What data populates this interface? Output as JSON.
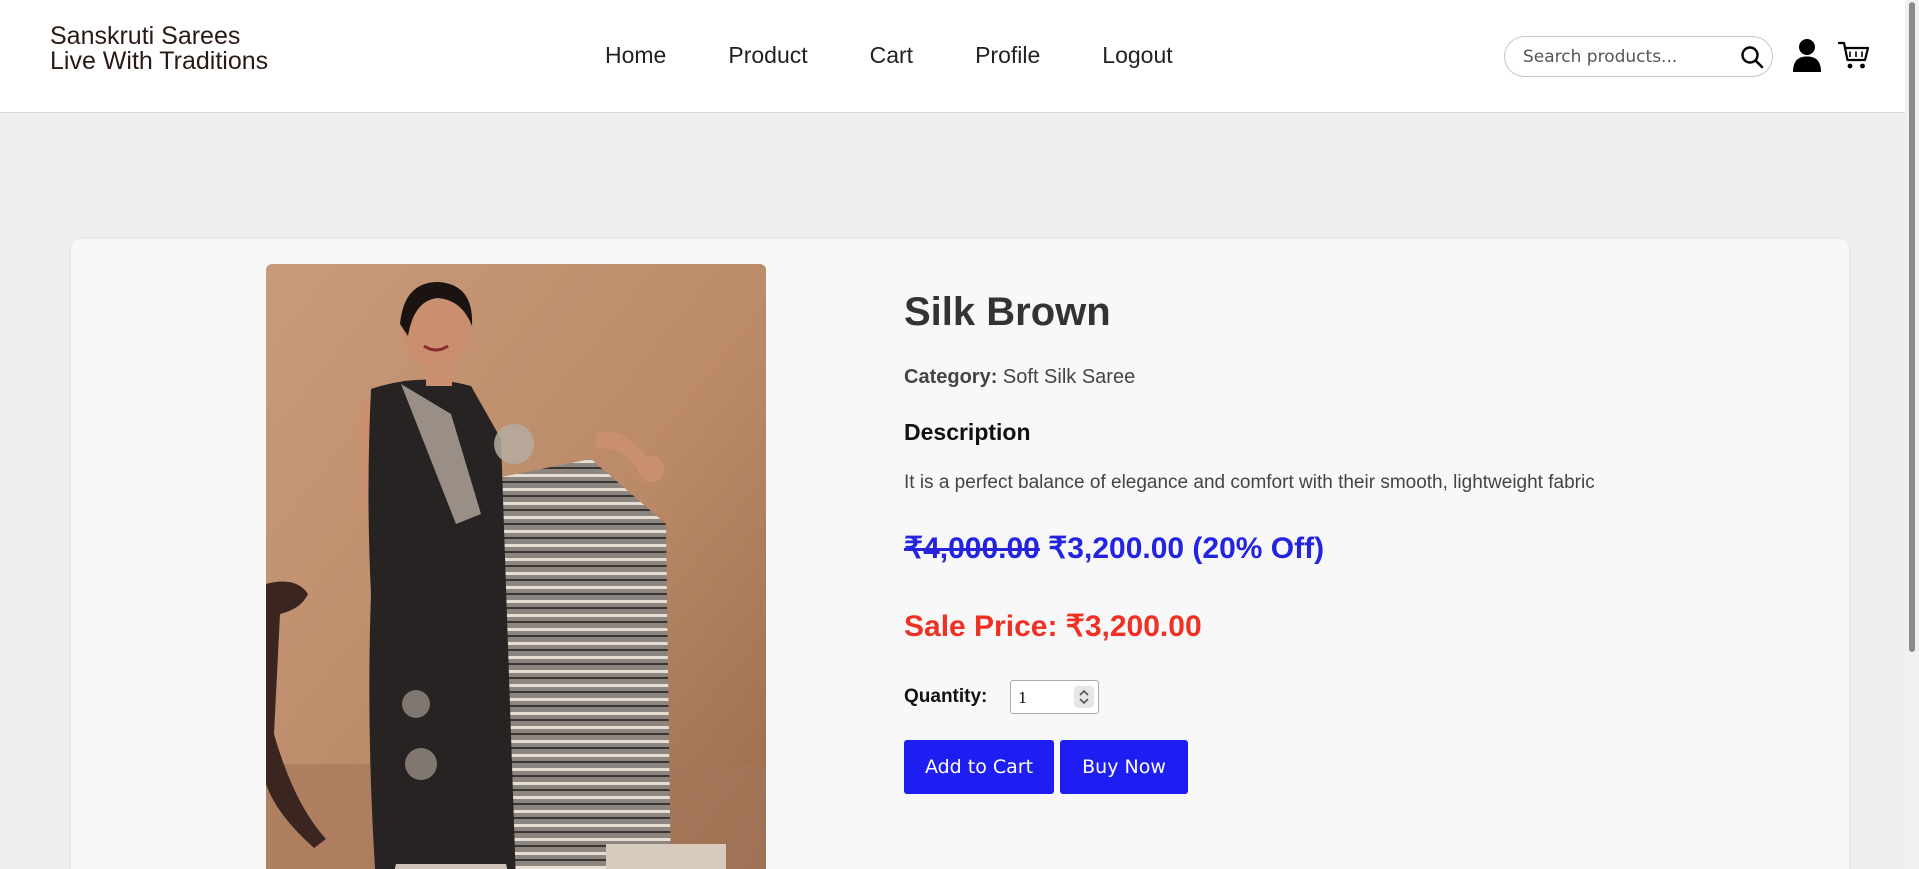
{
  "brand": {
    "line1": "Sanskruti Sarees",
    "line2": "Live With Traditions"
  },
  "nav": [
    {
      "label": "Home"
    },
    {
      "label": "Product"
    },
    {
      "label": "Cart"
    },
    {
      "label": "Profile"
    },
    {
      "label": "Logout"
    }
  ],
  "search": {
    "placeholder": "Search products...",
    "value": ""
  },
  "icons": {
    "search": "search-icon",
    "user": "user-icon",
    "cart": "cart-icon"
  },
  "product": {
    "title": "Silk Brown",
    "category_label": "Category:",
    "category_value": "Soft Silk Saree",
    "description_heading": "Description",
    "description": "It is a perfect balance of elegance and comfort with their smooth, lightweight fabric",
    "original_price": "₹4,000.00",
    "discounted_price": "₹3,200.00 (20% Off)",
    "sale_price": "Sale Price: ₹3,200.00",
    "quantity_label": "Quantity:",
    "quantity": "1",
    "add_to_cart_label": "Add to Cart",
    "buy_now_label": "Buy Now"
  },
  "colors": {
    "accent": "#1e1ef2",
    "price_blue": "#2323e0",
    "sale_red": "#ee3124",
    "background": "#efefef"
  }
}
